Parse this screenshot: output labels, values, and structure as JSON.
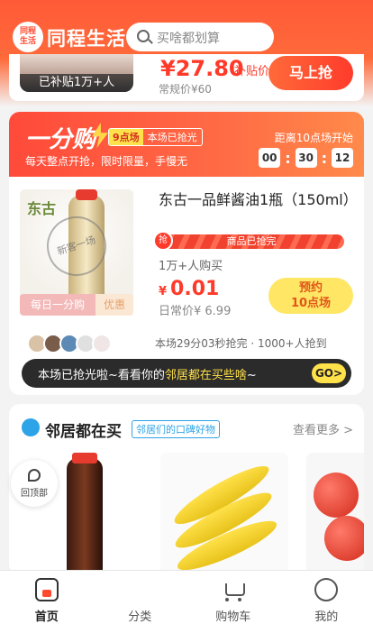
{
  "header": {
    "logo_text": "同程\n生活",
    "brand": "同程生活",
    "search_placeholder": "买啥都划算"
  },
  "top_card": {
    "subsidy": "已补贴1万+人",
    "price": "¥27.80",
    "price_tag": "补贴价",
    "original": "常规价¥60",
    "button": "马上抢"
  },
  "flash_sale": {
    "title": "一分购",
    "tag_time": "9点场",
    "tag_status": "本场已抢光",
    "subtitle": "每天整点开抢，限时限量，手慢无",
    "next_label": "距离10点场开始",
    "countdown": {
      "h": "00",
      "m": "30",
      "s": "12"
    },
    "product": {
      "brand_mark": "东古",
      "stamp": "新客一场",
      "title": "东古一品鲜酱油1瓶（150ml）",
      "progress_text": "商品已抢完",
      "progress_fraction": 1.0,
      "buyers": "1万+人购买",
      "price_symbol": "¥",
      "price": "0.01",
      "daily_price": "日常价¥ 6.99",
      "badge_left": "每日一分购",
      "badge_right": "优惠",
      "reserve_line1": "预约",
      "reserve_line2": "10点场"
    },
    "sold_info": "本场29分03秒抢完 · 1000+人抢到",
    "banner_text": "本场已抢光啦~看看你的",
    "banner_highlight": "邻居都在买些啥",
    "banner_end": "~",
    "go": "GO>"
  },
  "neighbors": {
    "title": "邻居都在买",
    "tag": "邻居们的口碑好物",
    "more": "查看更多 >",
    "return_label": "回顶部"
  },
  "tabbar": {
    "items": [
      {
        "label": "首页",
        "icon": "home-icon"
      },
      {
        "label": "分类",
        "icon": "category-icon"
      },
      {
        "label": "购物车",
        "icon": "cart-icon"
      },
      {
        "label": "我的",
        "icon": "profile-icon"
      }
    ]
  },
  "colors": {
    "accent": "#ff4a2f",
    "highlight": "#ffe14a",
    "link": "#2ea4e8"
  }
}
